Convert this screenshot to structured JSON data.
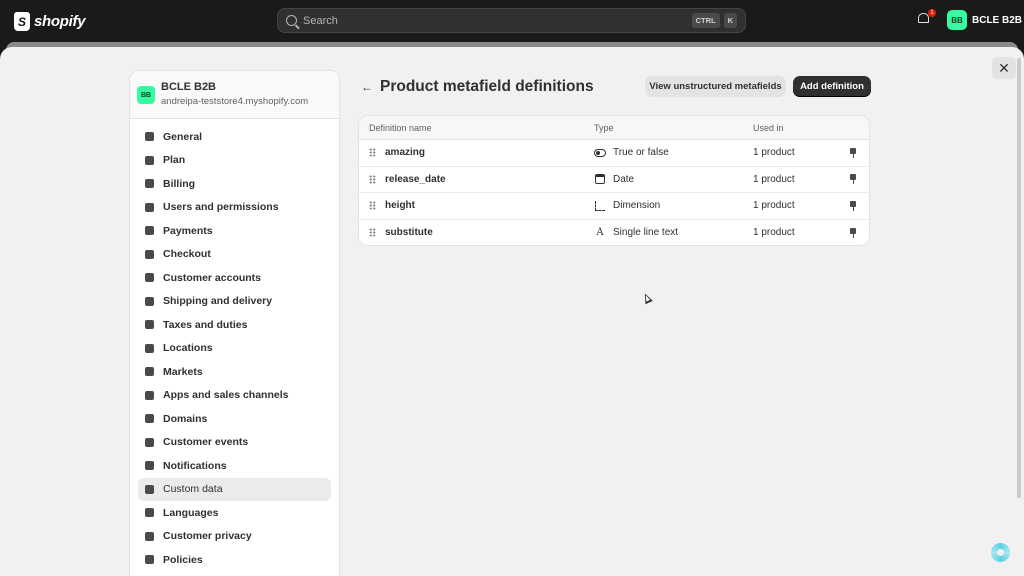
{
  "topbar": {
    "logo_text": "shopify",
    "search_placeholder": "Search",
    "shortcut_keys": [
      "CTRL",
      "K"
    ],
    "notification_count": "1",
    "account_initials": "BB",
    "account_name": "BCLE B2B",
    "accent_color": "#36fba1"
  },
  "sidebar": {
    "store_initials": "BB",
    "store_name": "BCLE B2B",
    "store_domain": "andreipa-teststore4.myshopify.com",
    "items": [
      {
        "label": "General",
        "icon": "store-icon"
      },
      {
        "label": "Plan",
        "icon": "chart-bars-icon"
      },
      {
        "label": "Billing",
        "icon": "dollar-icon"
      },
      {
        "label": "Users and permissions",
        "icon": "users-icon"
      },
      {
        "label": "Payments",
        "icon": "credit-card-icon"
      },
      {
        "label": "Checkout",
        "icon": "cart-icon"
      },
      {
        "label": "Customer accounts",
        "icon": "person-icon"
      },
      {
        "label": "Shipping and delivery",
        "icon": "truck-icon"
      },
      {
        "label": "Taxes and duties",
        "icon": "money-bag-icon"
      },
      {
        "label": "Locations",
        "icon": "location-pin-icon"
      },
      {
        "label": "Markets",
        "icon": "globe-icon"
      },
      {
        "label": "Apps and sales channels",
        "icon": "apps-icon"
      },
      {
        "label": "Domains",
        "icon": "domain-icon"
      },
      {
        "label": "Customer events",
        "icon": "cursor-click-icon"
      },
      {
        "label": "Notifications",
        "icon": "bell-icon"
      },
      {
        "label": "Custom data",
        "icon": "database-icon",
        "active": true
      },
      {
        "label": "Languages",
        "icon": "language-icon"
      },
      {
        "label": "Customer privacy",
        "icon": "lock-icon"
      },
      {
        "label": "Policies",
        "icon": "document-icon"
      }
    ]
  },
  "main": {
    "title": "Product metafield definitions",
    "view_unstructured_label": "View unstructured metafields",
    "add_definition_label": "Add definition",
    "columns": [
      "Definition name",
      "Type",
      "Used in"
    ],
    "rows": [
      {
        "name": "amazing",
        "type": "True or false",
        "type_icon": "toggle-icon",
        "used_in": "1 product"
      },
      {
        "name": "release_date",
        "type": "Date",
        "type_icon": "calendar-icon",
        "used_in": "1 product"
      },
      {
        "name": "height",
        "type": "Dimension",
        "type_icon": "dimension-icon",
        "used_in": "1 product"
      },
      {
        "name": "substitute",
        "type": "Single line text",
        "type_icon": "text-icon",
        "used_in": "1 product"
      }
    ]
  }
}
